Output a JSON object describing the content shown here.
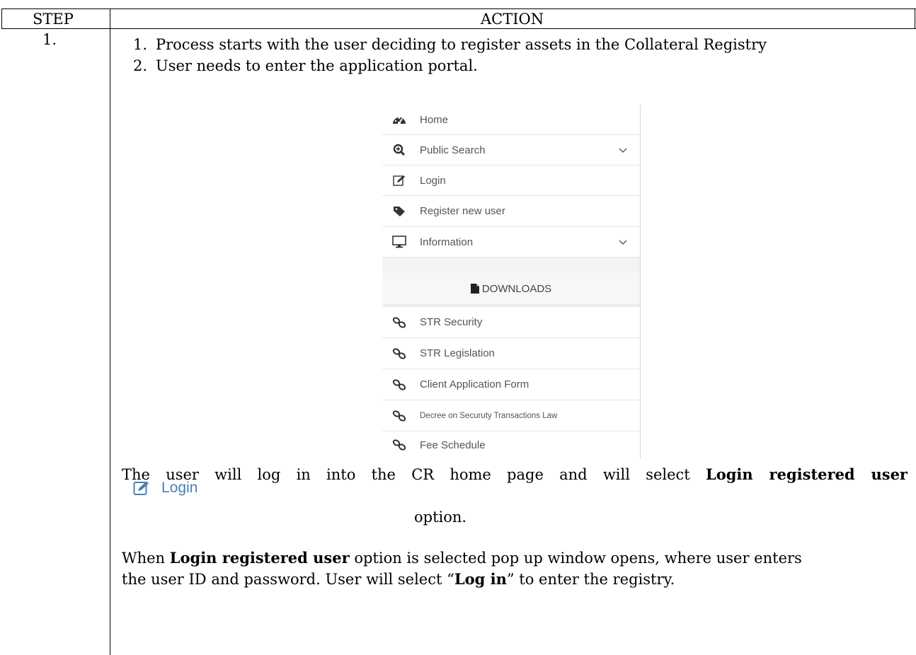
{
  "table": {
    "col_step": "STEP",
    "col_action": "ACTION",
    "step_number": "1."
  },
  "steps": [
    {
      "num": "1.",
      "text": "Process starts with the user deciding to register assets in the Collateral Registry"
    },
    {
      "num": "2.",
      "text": "User needs to enter the application portal."
    }
  ],
  "menu": {
    "items": [
      {
        "label": "Home",
        "icon": "dashboard-icon"
      },
      {
        "label": "Public Search",
        "icon": "search-plus-icon",
        "chevron": true
      },
      {
        "label": "Login",
        "icon": "edit-icon"
      },
      {
        "label": "Register new user",
        "icon": "tag-icon"
      },
      {
        "label": "Information",
        "icon": "desktop-icon",
        "chevron": true
      }
    ],
    "downloads_label": "DOWNLOADS",
    "links": [
      {
        "label": "STR Security"
      },
      {
        "label": "STR Legislation"
      },
      {
        "label": "Client Application Form"
      },
      {
        "label": "Decree on Securuty Transactions Law"
      },
      {
        "label": "Fee Schedule"
      }
    ]
  },
  "para1": {
    "before": "The user will log in into the CR home page and will select ",
    "bold": "Login registered user",
    "inline_login_label": "Login",
    "after": "option."
  },
  "para2": {
    "line1_bold": "Login registered user",
    "line1_rest": " option is selected pop up window opens, where user enters",
    "line1_prefix": "When ",
    "line2_before": "the user ID and password. User will select “",
    "line2_bold": "Log in",
    "line2_after": "” to enter the registry."
  }
}
